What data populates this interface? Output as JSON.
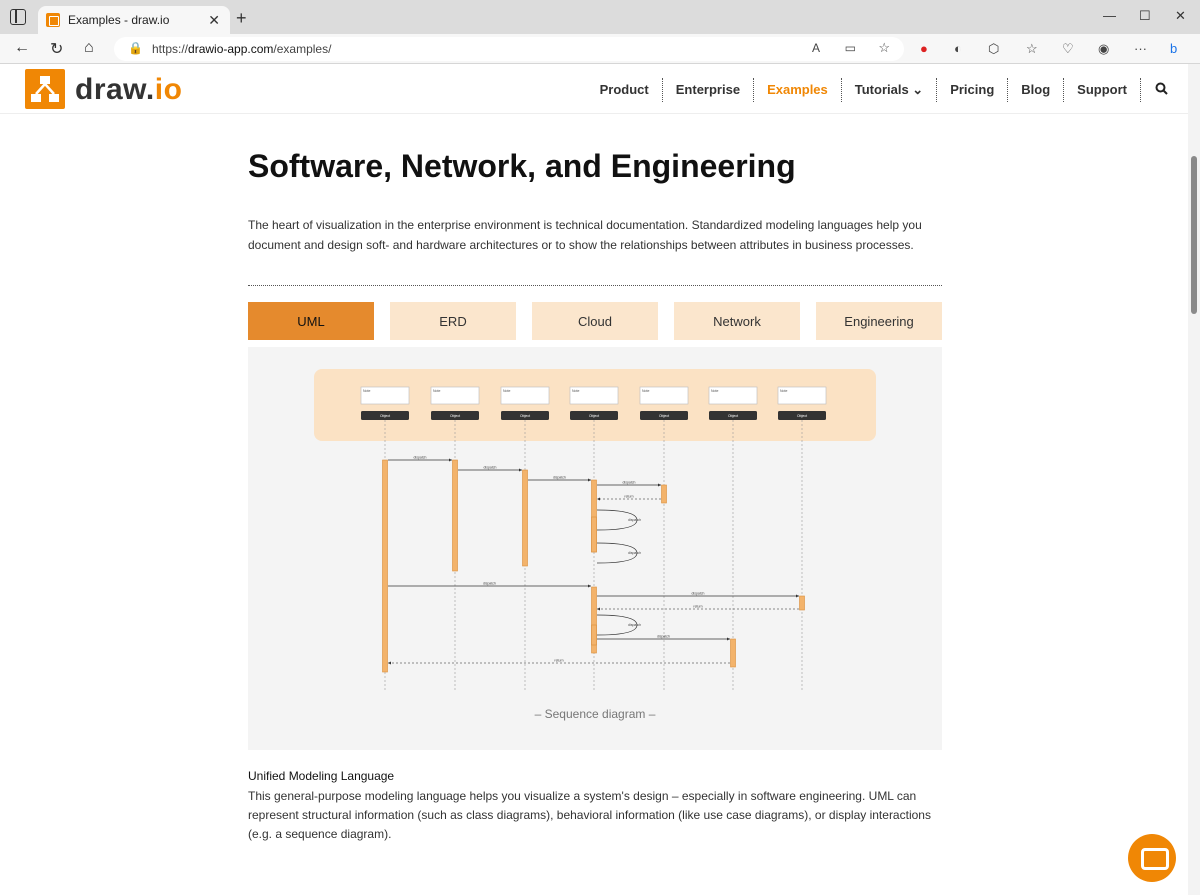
{
  "browser": {
    "tab_title": "Examples - draw.io",
    "url_prefix": "https://",
    "url_host": "drawio-app.com",
    "url_path": "/examples/"
  },
  "site": {
    "logo_main": "draw.",
    "logo_accent": "io",
    "nav": [
      {
        "label": "Product",
        "active": false
      },
      {
        "label": "Enterprise",
        "active": false
      },
      {
        "label": "Examples",
        "active": true
      },
      {
        "label": "Tutorials ⌄",
        "active": false
      },
      {
        "label": "Pricing",
        "active": false
      },
      {
        "label": "Blog",
        "active": false
      },
      {
        "label": "Support",
        "active": false
      }
    ]
  },
  "main": {
    "title": "Software, Network, and Engineering",
    "lead": "The heart of visualization in the enterprise environment is technical documentation. Standardized modeling languages help you document and design soft- and hardware architectures or to show the relationships between attributes in business processes.",
    "tabs": [
      {
        "label": "UML",
        "active": true
      },
      {
        "label": "ERD",
        "active": false
      },
      {
        "label": "Cloud",
        "active": false
      },
      {
        "label": "Network",
        "active": false
      },
      {
        "label": "Engineering",
        "active": false
      }
    ],
    "diagram_caption": "– Sequence diagram –",
    "diagram": {
      "note_label": "Note",
      "object_label": "Object",
      "messages": [
        "dispatch",
        "dispatch",
        "dispatch",
        "dispatch",
        "return",
        "dispatch",
        "dispatch",
        "dispatch",
        "dispatch",
        "return",
        "dispatch",
        "dispatch",
        "return"
      ]
    },
    "section_title": "Unified Modeling Language",
    "section_text": "This general-purpose modeling language helps you visualize a system's design – especially in software engineering. UML can represent structural information (such as class diagrams), behavioral information (like use case diagrams), or display interactions (e.g. a sequence diagram)."
  },
  "colors": {
    "accent": "#f08705",
    "tab_active": "#e58a2d",
    "tab_inactive": "#fbe6cd"
  }
}
